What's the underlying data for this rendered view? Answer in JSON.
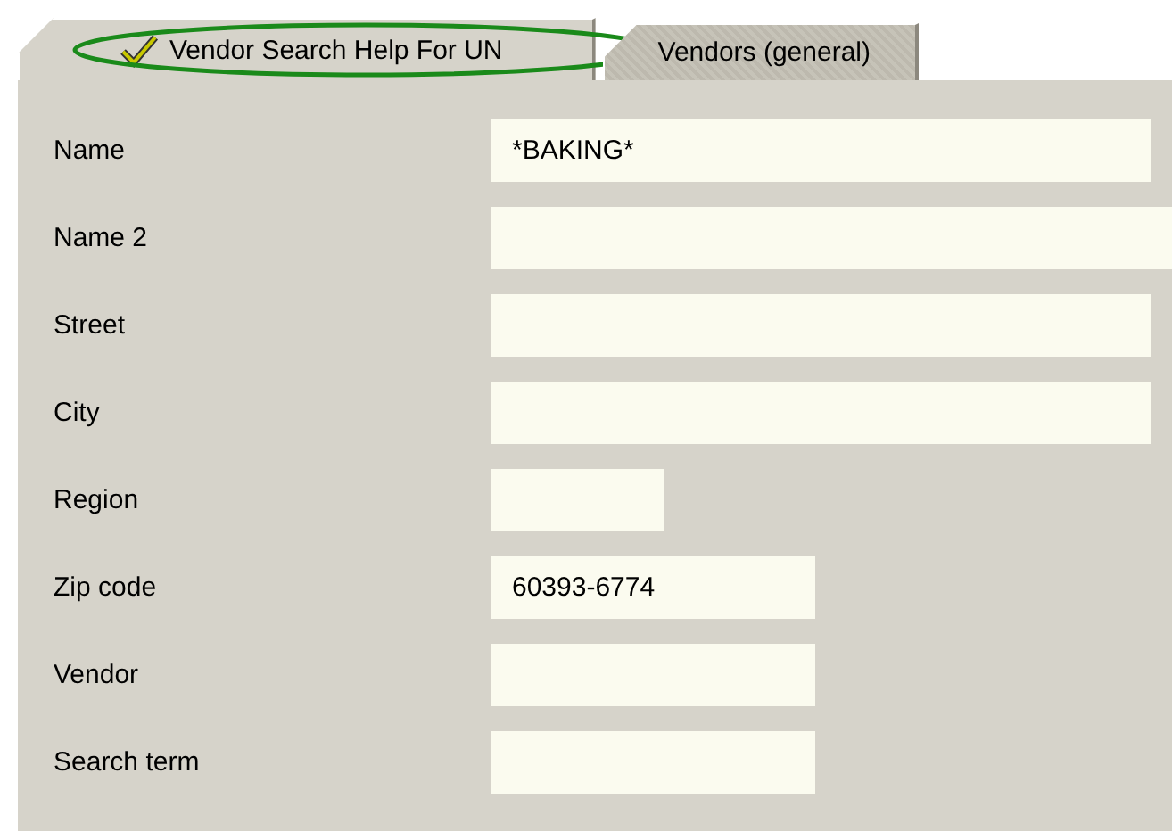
{
  "tabs": [
    {
      "label": "Vendor Search Help For UN",
      "selected": true,
      "checked": true,
      "circled": true
    },
    {
      "label": "Vendors (general)",
      "selected": false,
      "checked": false,
      "circled": false
    }
  ],
  "fields": [
    {
      "label": "Name",
      "value": "*BAKING*",
      "kind": "long"
    },
    {
      "label": "Name 2",
      "kind": "wide"
    },
    {
      "label": "Street",
      "kind": "long"
    },
    {
      "label": "City",
      "kind": "long"
    },
    {
      "label": "Region",
      "kind": "short"
    },
    {
      "label": "Zip code",
      "value": "60393-6774",
      "kind": "medium"
    },
    {
      "label": "Vendor",
      "kind": "medium"
    },
    {
      "label": "Search term",
      "kind": "medium"
    }
  ]
}
